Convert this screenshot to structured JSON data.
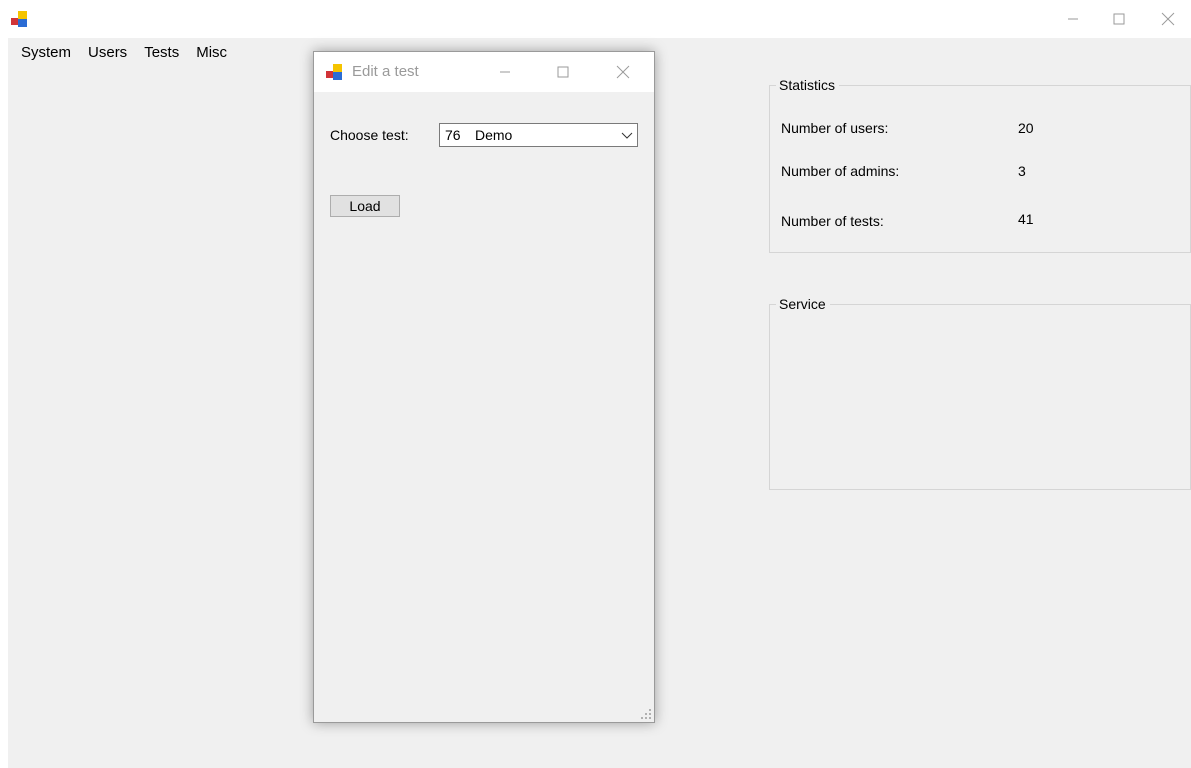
{
  "main_window": {
    "title": "",
    "menu": [
      "System",
      "Users",
      "Tests",
      "Misc"
    ]
  },
  "statistics": {
    "title": "Statistics",
    "rows": [
      {
        "label": "Number of users:",
        "value": "20"
      },
      {
        "label": "Number of admins:",
        "value": "3"
      },
      {
        "label": "Number of tests:",
        "value": "41"
      }
    ]
  },
  "service": {
    "title": "Service"
  },
  "dialog": {
    "title": "Edit a test",
    "choose_label": "Choose test:",
    "combo": {
      "id": "76",
      "name": "Demo"
    },
    "load_label": "Load"
  },
  "colors": {
    "client_bg": "#f0f0f0",
    "dialog_title_text": "#9a9a9a",
    "icon_red": "#d13438",
    "icon_yellow": "#f5c400",
    "icon_blue": "#2b6cd4"
  },
  "icons": [
    "app-icon",
    "minimize-icon",
    "maximize-icon",
    "close-icon",
    "chevron-down-icon",
    "resize-grip-icon"
  ]
}
